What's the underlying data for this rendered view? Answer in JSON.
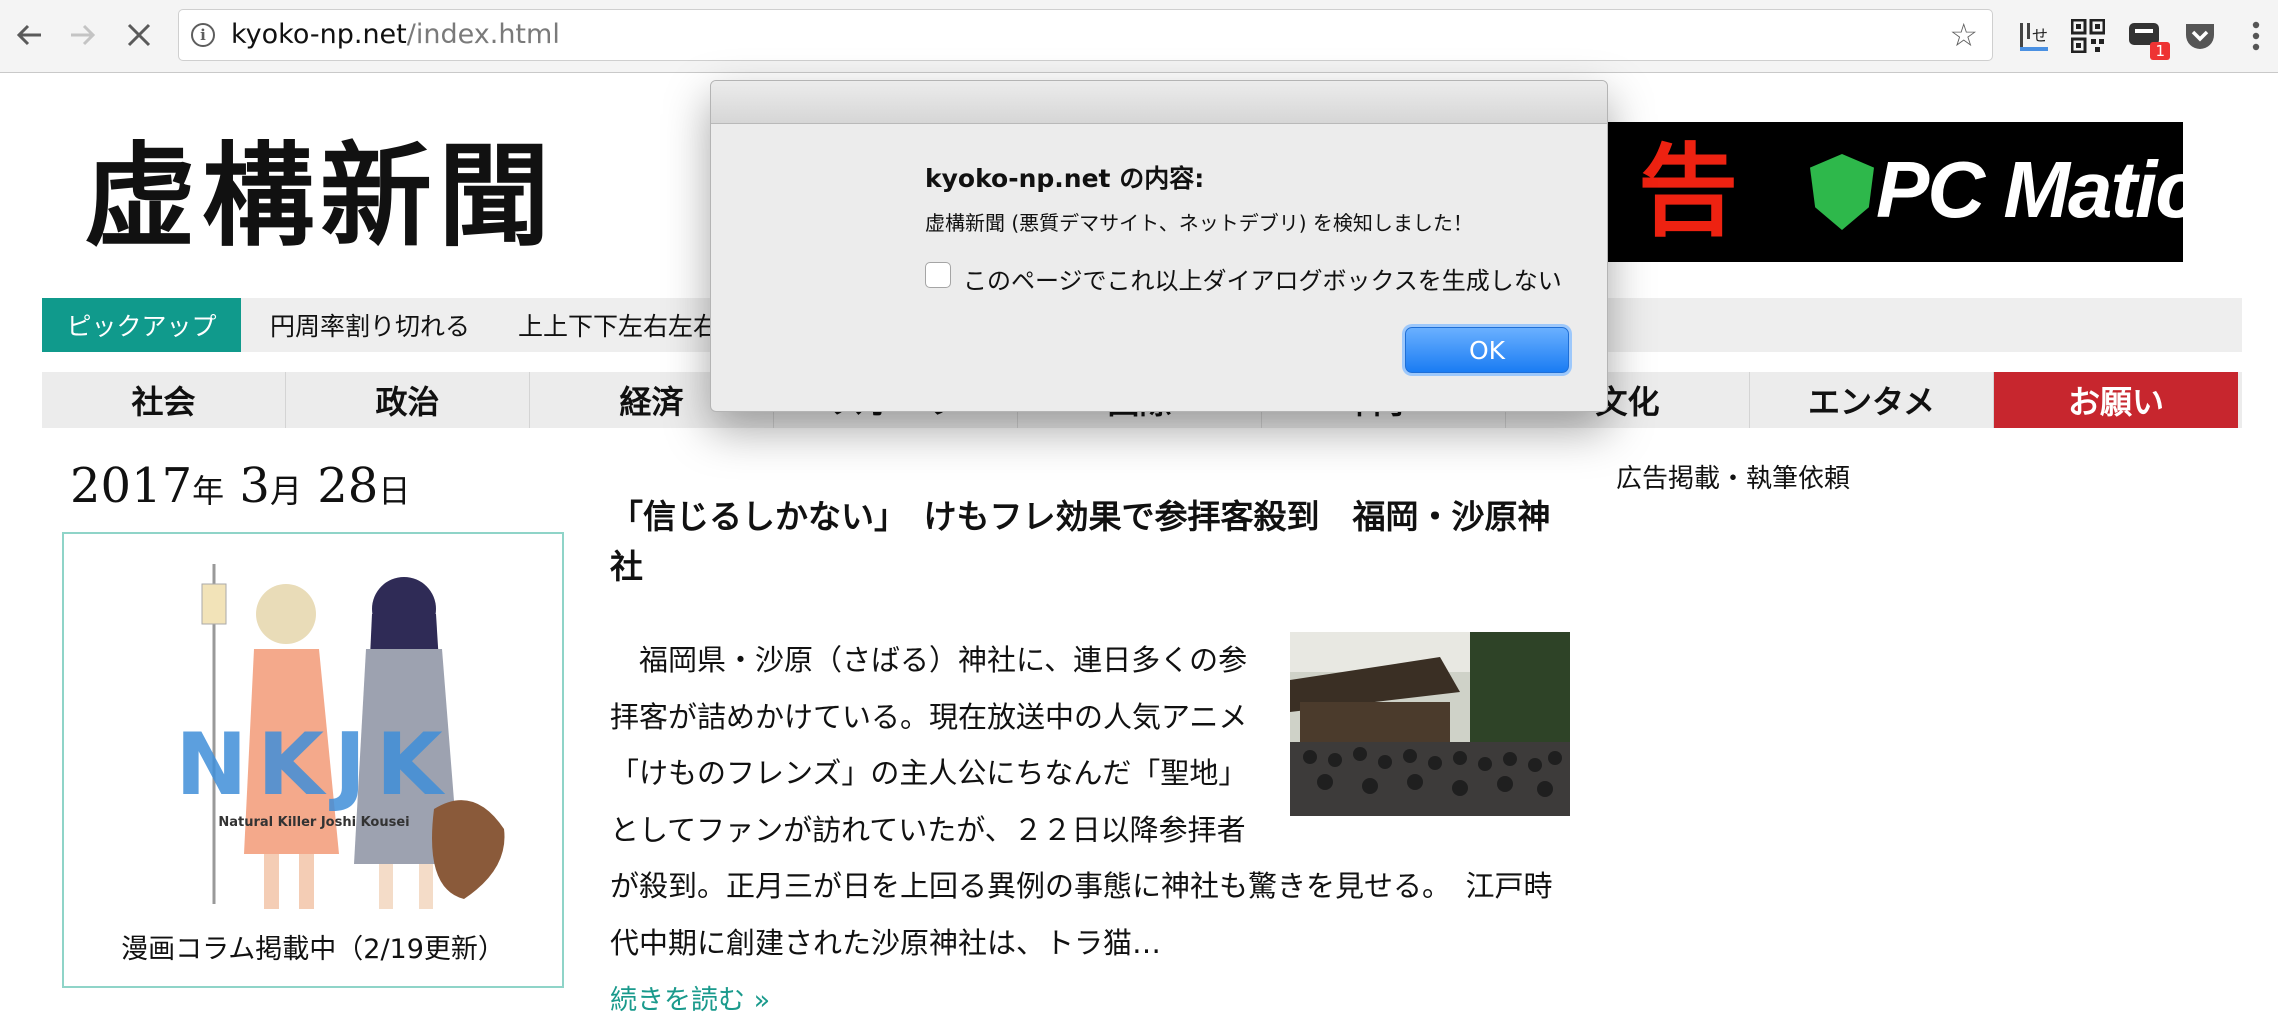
{
  "browser": {
    "url_host": "kyoko-np.net",
    "url_path": "/index.html",
    "notification_badge": "1"
  },
  "site": {
    "logo": "虚構新聞"
  },
  "ad": {
    "text_red": "告",
    "brand": "PC Matic"
  },
  "pickup": {
    "label": "ピックアップ",
    "items": [
      "円周率割り切れる",
      "上上下下左右左右"
    ]
  },
  "categories": [
    "社会",
    "政治",
    "経済",
    "スポーツ",
    "国際",
    "科学",
    "文化",
    "エンタメ",
    "お願い"
  ],
  "date": {
    "year": "2017",
    "year_unit": "年",
    "month": " 3",
    "month_unit": "月",
    "day": " 28",
    "day_unit": "日"
  },
  "manga": {
    "caption": "漫画コラム掲載中（2/19更新）",
    "logo_letters": "NKJK",
    "subtitle": "Natural Killer Joshi Kousei"
  },
  "article": {
    "headline": "「信じるしかない」　けもフレ効果で参拝客殺到　福岡・沙原神社",
    "body": "　福岡県・沙原（さばる）神社に、連日多くの参拝客が詰めかけている。現在放送中の人気アニメ「けものフレンズ」の主人公にちなんだ「聖地」としてファンが訪れていたが、２２日以降参拝者が殺到。正月三が日を上回る異例の事態に神社も驚きを見せる。　江戸時代中期に創建された沙原神社は、トラ猫…",
    "read_more": "続きを読む »"
  },
  "sidebar": {
    "link": "広告掲載・執筆依頼"
  },
  "dialog": {
    "title": "kyoko-np.net の内容:",
    "message": "虚構新聞 (悪質デマサイト、ネットデブリ) を検知しました！",
    "checkbox_label": "このページでこれ以上ダイアログボックスを生成しない",
    "ok_label": "OK"
  }
}
